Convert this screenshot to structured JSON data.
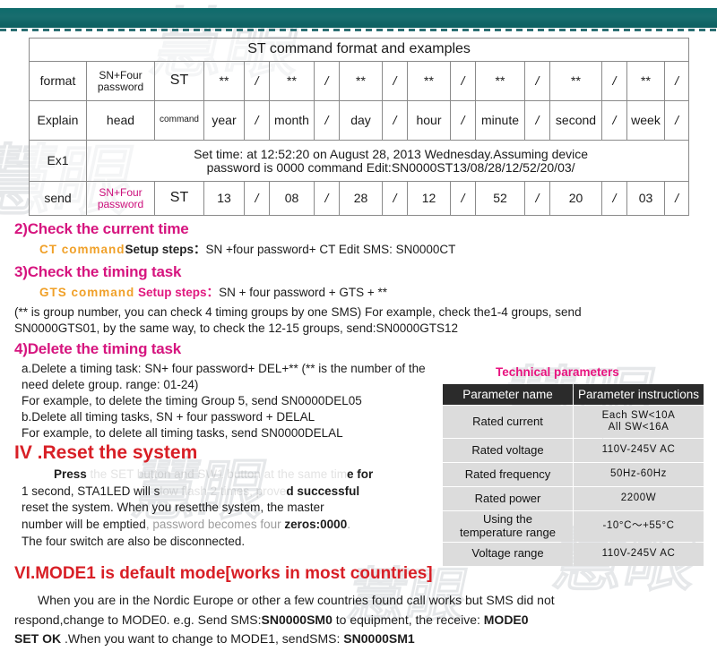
{
  "header": {
    "bar_color": "#0f6b6c",
    "dash_color": "#2b6f73"
  },
  "watermarks": [
    "慧眼",
    "慧眼",
    "慧眼",
    "慧眼",
    "慧眼",
    "慧眼"
  ],
  "st_table": {
    "title": "ST command format and examples",
    "rows": {
      "format": {
        "label": "format",
        "cells": [
          "SN+Four password",
          "ST",
          "**",
          "/",
          "**",
          "/",
          "**",
          "/",
          "**",
          "/",
          "**",
          "/",
          "**",
          "/",
          "**",
          "/"
        ]
      },
      "explain": {
        "label": "Explain",
        "cells": [
          "head",
          "command",
          "year",
          "/",
          "month",
          "/",
          "day",
          "/",
          "hour",
          "/",
          "minute",
          "/",
          "second",
          "/",
          "week",
          "/"
        ]
      },
      "ex1": {
        "label": "Ex1",
        "text_line1": "Set time: at 12:52:20 on August 28, 2013 Wednesday.Assuming device",
        "text_line2": "password is 0000 command Edit:SN0000ST13/08/28/12/52/20/03/"
      },
      "send": {
        "label": "send",
        "cells": [
          "SN+Four password",
          "ST",
          "13",
          "/",
          "08",
          "/",
          "28",
          "/",
          "12",
          "/",
          "52",
          "/",
          "20",
          "/",
          "03",
          "/"
        ]
      }
    }
  },
  "sections": {
    "s2": {
      "heading": "2)Check the current time",
      "command": "CT  command",
      "steps": "Setup steps：",
      "steps_rest": "SN +four password+ CT  Edit SMS: SN0000CT"
    },
    "s3": {
      "heading": "3)Check the timing task",
      "command": "GTS  command",
      "steps": "Setup steps：",
      "steps_rest": "SN + four password + GTS + **",
      "body_line1": "(** is group number, you can check 4 timing groups by one SMS) For example, check the1-4 groups, send",
      "body_line2": "SN0000GTS01, by the same way, to check the 12-15 groups, send:SN0000GTS12"
    },
    "s4": {
      "heading": "4)Delete the timing task",
      "line_a1": "a.Delete a timing task: SN+ four password+ DEL+** (** is the number of the",
      "line_a2": "need delete group. range: 01-24)",
      "line_a3": "For example, to delete the timing Group 5, send SN0000DEL05",
      "line_b1": "b.Delete all timing tasks, SN + four password + DELAL",
      "line_b2": "For example, to delete all timing tasks, send SN0000DELAL"
    },
    "reset": {
      "heading": "IV .Reset the system",
      "l1_a": "Press",
      "l1_b": " the SET button and SW1 button at the same tim",
      "l1_c": "e for",
      "l2_a": "1 second, STA1LED will s",
      "l2_b": "low flash 2 times, prove",
      "l2_c": "d successful",
      "l3": "reset  the system. When you resetthe system, the master",
      "l4_a": "number will be emptied",
      "l4_b": ", password becomes four ",
      "l4_c": "zeros:0000",
      "l4_d": ".",
      "l5": "The four switch are also be disconnected."
    },
    "mode": {
      "heading": "VI.MODE1 is default mode[works in most countries]",
      "l1": "When you are in the Nordic Europe or other a few countries found call works but SMS did not",
      "l2_a": "respond,change to MODE0. e.g. Send SMS:",
      "l2_b": "SN0000SM0",
      "l2_c": " to equipment, the receive: ",
      "l2_d": "MODE0",
      "l3_a": "SET OK",
      "l3_b": " .When you want to change to MODE1, sendSMS: ",
      "l3_c": "SN0000SM1"
    }
  },
  "tech": {
    "title": "Technical parameters",
    "col1": "Parameter name",
    "col2": "Parameter instructions",
    "rows": [
      {
        "name": "Rated current",
        "value": "Each SW<10A\nAll SW<16A"
      },
      {
        "name": "Rated voltage",
        "value": "110V-245V AC"
      },
      {
        "name": "Rated frequency",
        "value": "50Hz-60Hz"
      },
      {
        "name": "Rated power",
        "value": "2200W"
      },
      {
        "name": "Using the\ntemperature range",
        "value": "-10°C～+55°C"
      },
      {
        "name": "Voltage range",
        "value": "110V-245V AC"
      }
    ]
  },
  "colors": {
    "pink_heading": "#d6157f",
    "red_heading": "#d81f26",
    "orange_cmd": "#f0a028",
    "magenta_table": "#cc0f7b",
    "teal_bar": "#0f6b6c"
  }
}
